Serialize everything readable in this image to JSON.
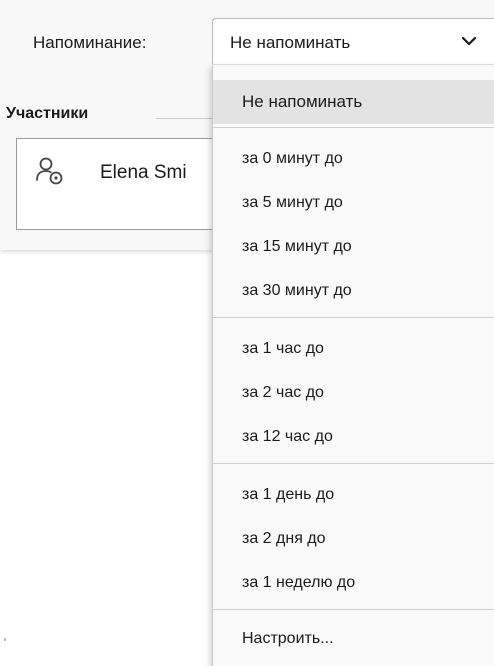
{
  "reminder": {
    "label": "Напоминание:",
    "selected_value": "Не напоминать"
  },
  "participants": {
    "title": "Участники",
    "items": [
      {
        "name": "Elena Smi",
        "icon": "person-optional-icon"
      }
    ]
  },
  "dropdown": {
    "options": [
      {
        "label": "Не напоминать",
        "selected": true
      },
      {
        "label": "за 0 минут до"
      },
      {
        "label": "за 5 минут до"
      },
      {
        "label": "за 15 минут до"
      },
      {
        "label": "за 30 минут до"
      },
      {
        "label": "за 1 час до"
      },
      {
        "label": "за 2 час до"
      },
      {
        "label": "за 12 час до"
      },
      {
        "label": "за 1 день до"
      },
      {
        "label": "за 2 дня до"
      },
      {
        "label": "за 1 неделю до"
      },
      {
        "label": "Настроить..."
      }
    ]
  },
  "colors": {
    "panel_bg": "#f8f8f8",
    "dropdown_bg": "#f9f9f9",
    "selected_bg": "#e3e3e3",
    "separator": "#d0d0d0",
    "border": "#9a9a9a"
  }
}
